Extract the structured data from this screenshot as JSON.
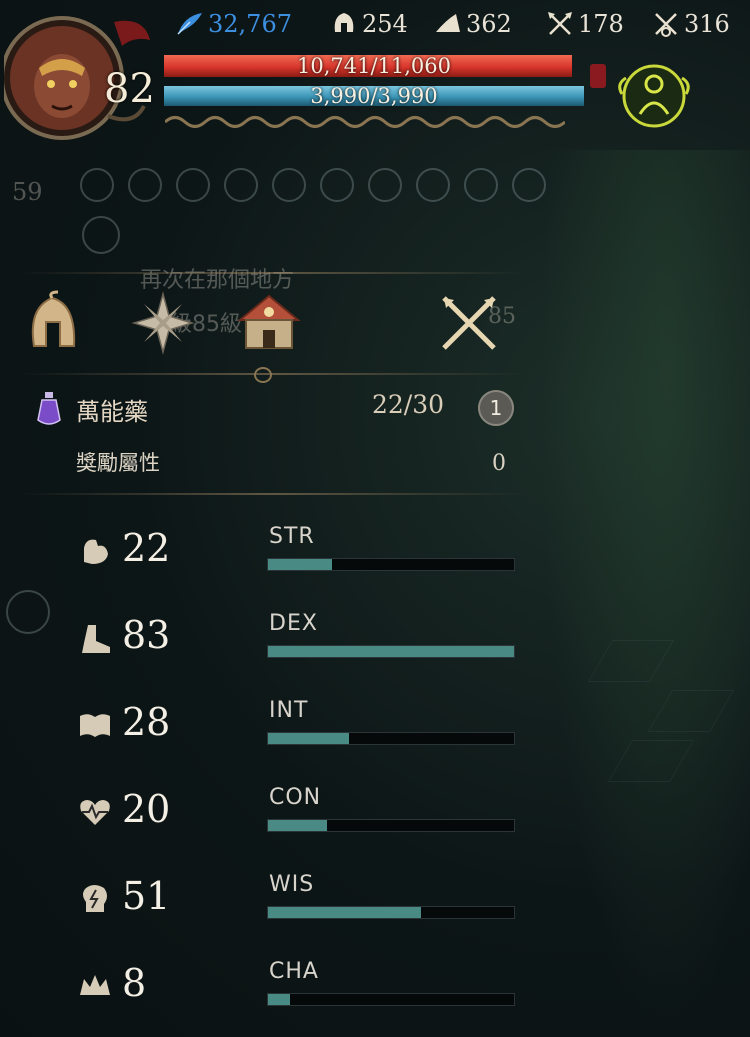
{
  "hud": {
    "level": "82",
    "resources": [
      {
        "icon": "blue-feather-icon",
        "value": "32,767",
        "color": "#3d8fe0"
      },
      {
        "icon": "helmet-icon",
        "value": "254",
        "color": "#efe7d6"
      },
      {
        "icon": "wing-icon",
        "value": "362",
        "color": "#efe7d6"
      },
      {
        "icon": "crossed-arrows-icon",
        "value": "178",
        "color": "#efe7d6"
      },
      {
        "icon": "crossed-swords-icon",
        "value": "316",
        "color": "#efe7d6"
      }
    ],
    "hp": {
      "text": "10,741/11,060",
      "fraction": 0.971,
      "color": "#d8362c"
    },
    "mp": {
      "text": "3,990/3,990",
      "fraction": 1.0,
      "color": "#3b95b6"
    }
  },
  "background": {
    "level_badge": "59",
    "quest_text": "再次在那個地方",
    "quest_level": "級85級",
    "quest_number": "85"
  },
  "tabs": [
    {
      "name": "tab-character",
      "icon": "helmet-icon",
      "active": true
    },
    {
      "name": "tab-skills",
      "icon": "star-compass-icon",
      "active": false
    },
    {
      "name": "tab-house",
      "icon": "house-icon",
      "active": false
    },
    {
      "name": "tab-combat",
      "icon": "crossed-swords-icon",
      "active": false
    }
  ],
  "elixir": {
    "label": "萬能藥",
    "count": "22/30",
    "badge": "1"
  },
  "bonus": {
    "label": "獎勵屬性",
    "value": "0"
  },
  "stats": [
    {
      "key": "STR",
      "value": "22",
      "fraction": 0.26,
      "icon": "arm-icon"
    },
    {
      "key": "DEX",
      "value": "83",
      "fraction": 1.0,
      "icon": "boot-icon"
    },
    {
      "key": "INT",
      "value": "28",
      "fraction": 0.33,
      "icon": "book-icon"
    },
    {
      "key": "CON",
      "value": "20",
      "fraction": 0.24,
      "icon": "heartbeat-icon"
    },
    {
      "key": "WIS",
      "value": "51",
      "fraction": 0.62,
      "icon": "head-bolt-icon"
    },
    {
      "key": "CHA",
      "value": "8",
      "fraction": 0.09,
      "icon": "crown-icon"
    }
  ]
}
